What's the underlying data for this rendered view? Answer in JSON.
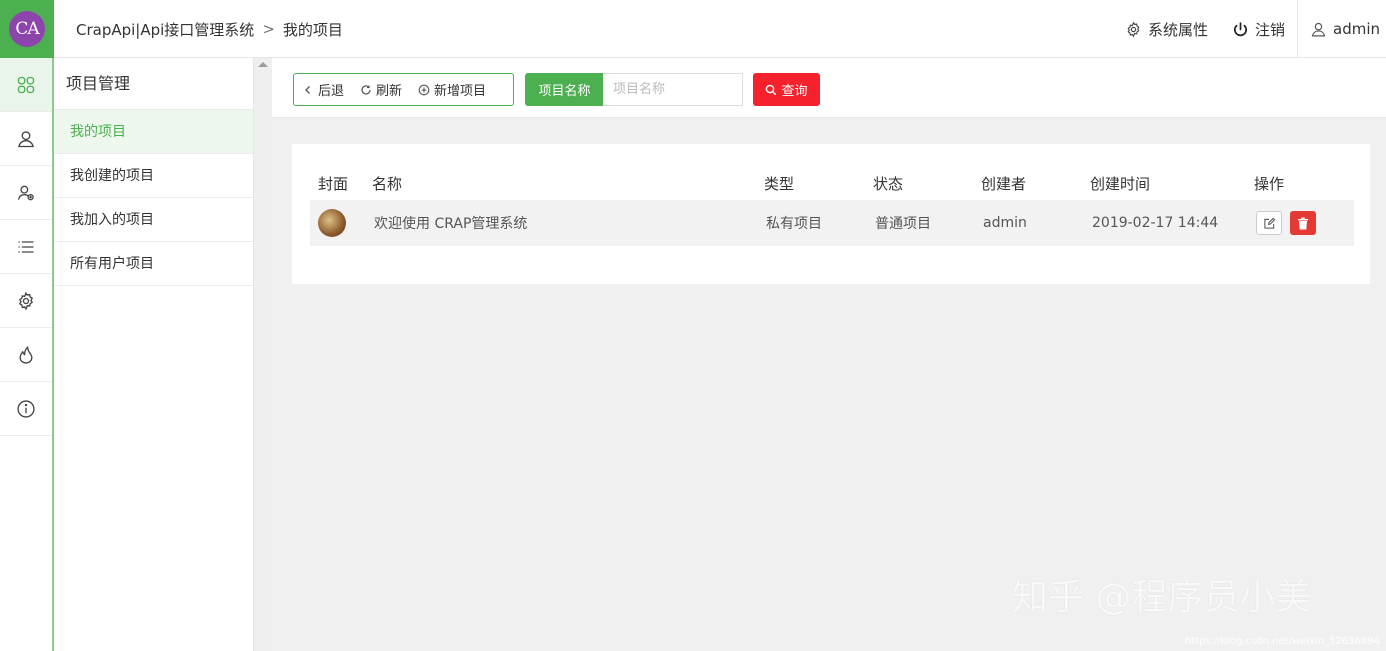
{
  "header": {
    "logo_text": "CA",
    "breadcrumb": [
      "CrapApi|Api接口管理系统",
      "我的项目"
    ],
    "breadcrumb_separator": ">",
    "system_settings": "系统属性",
    "logout": "注销",
    "user": "admin"
  },
  "rail": {
    "items": [
      "apps-icon",
      "user-icon",
      "user-group-icon",
      "list-icon",
      "gear-icon",
      "fire-icon",
      "info-icon"
    ],
    "active_index": 0
  },
  "submenu": {
    "title": "项目管理",
    "items": [
      {
        "label": "我的项目",
        "active": true
      },
      {
        "label": "我创建的项目",
        "active": false
      },
      {
        "label": "我加入的项目",
        "active": false
      },
      {
        "label": "所有用户项目",
        "active": false
      }
    ]
  },
  "toolbar": {
    "back": "后退",
    "refresh": "刷新",
    "add_project": "新增项目",
    "search_label": "项目名称",
    "search_placeholder": "项目名称",
    "search_value": "",
    "query": "查询"
  },
  "table": {
    "columns": [
      "封面",
      "名称",
      "类型",
      "状态",
      "创建者",
      "创建时间",
      "操作"
    ],
    "rows": [
      {
        "name": "欢迎使用 CRAP管理系统",
        "type": "私有项目",
        "status": "普通项目",
        "creator": "admin",
        "created": "2019-02-17 14:44"
      }
    ]
  },
  "watermark": {
    "text": "知乎 @程序员小美",
    "url": "https://blog.csdn.net/weixin_52636894"
  },
  "colors": {
    "primary": "#4caf50",
    "danger": "#f5222d",
    "logo_circle": "#8e44ad"
  }
}
